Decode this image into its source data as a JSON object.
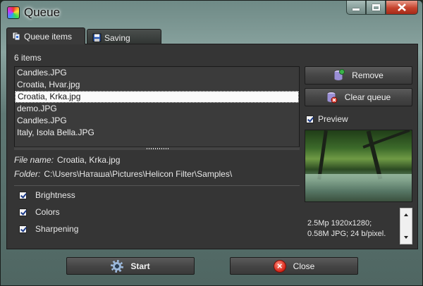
{
  "window": {
    "title": "Queue"
  },
  "tabs": [
    {
      "label": "Queue items",
      "active": true
    },
    {
      "label": "Saving results",
      "active": false
    }
  ],
  "queue": {
    "count_label": "6 items",
    "items": [
      {
        "label": "Candles.JPG",
        "selected": false
      },
      {
        "label": "Croatia, Hvar.jpg",
        "selected": false
      },
      {
        "label": "Croatia, Krka.jpg",
        "selected": true
      },
      {
        "label": "demo.JPG",
        "selected": false
      },
      {
        "label": "Candles.JPG",
        "selected": false
      },
      {
        "label": "Italy, Isola Bella.JPG",
        "selected": false
      }
    ]
  },
  "file_info": {
    "file_name_label": "File name:",
    "file_name": "Croatia, Krka.jpg",
    "folder_label": "Folder:",
    "folder": "C:\\Users\\Наташа\\Pictures\\Helicon Filter\\Samples\\"
  },
  "filters": [
    {
      "label": "Brightness",
      "checked": true
    },
    {
      "label": "Colors",
      "checked": true
    },
    {
      "label": "Sharpening",
      "checked": true
    }
  ],
  "side": {
    "remove_label": "Remove",
    "clear_label": "Clear queue",
    "preview_label": "Preview",
    "meta_line1": "2.5Mp 1920x1280;",
    "meta_line2": "0.58M JPG; 24 b/pixel."
  },
  "footer": {
    "start_label": "Start",
    "close_label": "Close"
  },
  "icons": {
    "app": "app-icon",
    "minimize": "minimize-icon",
    "maximize": "maximize-icon",
    "close": "close-icon",
    "remove": "database-remove-icon",
    "clear": "database-clear-icon",
    "start": "gear-icon",
    "cancel": "x-circle-icon"
  }
}
